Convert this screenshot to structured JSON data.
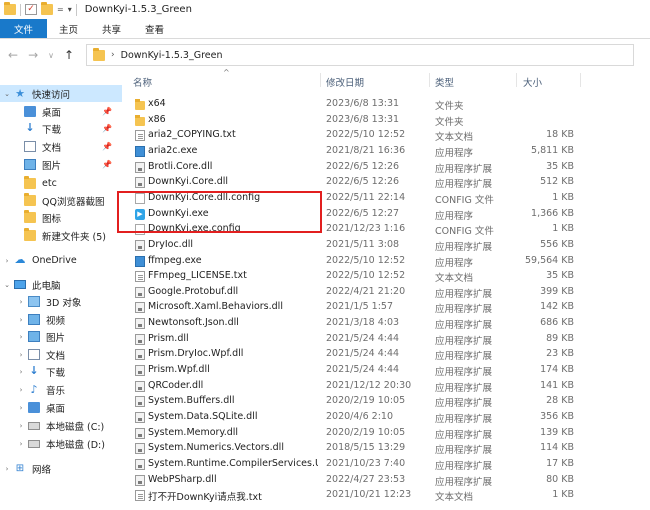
{
  "window": {
    "title": "DownKyi-1.5.3_Green"
  },
  "ribbon": {
    "tabs": [
      "文件",
      "主页",
      "共享",
      "查看"
    ]
  },
  "address": {
    "path": "DownKyi-1.5.3_Green"
  },
  "sidebar": {
    "items": [
      {
        "label": "快速访问",
        "icon": "star-icon",
        "kind": "group"
      },
      {
        "label": "桌面",
        "icon": "desktop-icon",
        "pinned": true
      },
      {
        "label": "下载",
        "icon": "download-icon",
        "pinned": true
      },
      {
        "label": "文档",
        "icon": "document-icon",
        "pinned": true
      },
      {
        "label": "图片",
        "icon": "picture-icon",
        "pinned": true
      },
      {
        "label": "etc",
        "icon": "folder-icon"
      },
      {
        "label": "QQ浏览器截图",
        "icon": "folder-icon"
      },
      {
        "label": "图标",
        "icon": "folder-icon"
      },
      {
        "label": "新建文件夹 (5)",
        "icon": "folder-icon"
      },
      {
        "label": "OneDrive",
        "icon": "cloud-icon",
        "kind": "group"
      },
      {
        "label": "此电脑",
        "icon": "computer-icon",
        "kind": "group"
      },
      {
        "label": "3D 对象",
        "icon": "cube-icon"
      },
      {
        "label": "视频",
        "icon": "video-icon"
      },
      {
        "label": "图片",
        "icon": "picture-icon"
      },
      {
        "label": "文档",
        "icon": "document-icon"
      },
      {
        "label": "下载",
        "icon": "download-icon"
      },
      {
        "label": "音乐",
        "icon": "music-icon"
      },
      {
        "label": "桌面",
        "icon": "desktop-icon"
      },
      {
        "label": "本地磁盘 (C:)",
        "icon": "drive-icon"
      },
      {
        "label": "本地磁盘 (D:)",
        "icon": "drive-icon"
      },
      {
        "label": "网络",
        "icon": "network-icon",
        "kind": "group"
      }
    ]
  },
  "columns": {
    "name": "名称",
    "date": "修改日期",
    "type": "类型",
    "size": "大小"
  },
  "files": [
    {
      "name": "x64",
      "date": "2023/6/8 13:31",
      "type": "文件夹",
      "size": "",
      "icon": "folder"
    },
    {
      "name": "x86",
      "date": "2023/6/8 13:31",
      "type": "文件夹",
      "size": "",
      "icon": "folder"
    },
    {
      "name": "aria2_COPYING.txt",
      "date": "2022/5/10 12:52",
      "type": "文本文档",
      "size": "18 KB",
      "icon": "txt"
    },
    {
      "name": "aria2c.exe",
      "date": "2021/8/21 16:36",
      "type": "应用程序",
      "size": "5,811 KB",
      "icon": "exe"
    },
    {
      "name": "Brotli.Core.dll",
      "date": "2022/6/5 12:26",
      "type": "应用程序扩展",
      "size": "35 KB",
      "icon": "dll"
    },
    {
      "name": "DownKyi.Core.dll",
      "date": "2022/6/5 12:26",
      "type": "应用程序扩展",
      "size": "512 KB",
      "icon": "dll"
    },
    {
      "name": "DownKyi.Core.dll.config",
      "date": "2022/5/11 22:14",
      "type": "CONFIG 文件",
      "size": "1 KB",
      "icon": "cfg"
    },
    {
      "name": "DownKyi.exe",
      "date": "2022/6/5 12:27",
      "type": "应用程序",
      "size": "1,366 KB",
      "icon": "app"
    },
    {
      "name": "DownKyi.exe.config",
      "date": "2021/12/23 1:16",
      "type": "CONFIG 文件",
      "size": "1 KB",
      "icon": "cfg"
    },
    {
      "name": "DryIoc.dll",
      "date": "2021/5/11 3:08",
      "type": "应用程序扩展",
      "size": "556 KB",
      "icon": "dll"
    },
    {
      "name": "ffmpeg.exe",
      "date": "2022/5/10 12:52",
      "type": "应用程序",
      "size": "59,564 KB",
      "icon": "exe"
    },
    {
      "name": "FFmpeg_LICENSE.txt",
      "date": "2022/5/10 12:52",
      "type": "文本文档",
      "size": "35 KB",
      "icon": "txt"
    },
    {
      "name": "Google.Protobuf.dll",
      "date": "2022/4/21 21:20",
      "type": "应用程序扩展",
      "size": "399 KB",
      "icon": "dll"
    },
    {
      "name": "Microsoft.Xaml.Behaviors.dll",
      "date": "2021/1/5 1:57",
      "type": "应用程序扩展",
      "size": "142 KB",
      "icon": "dll"
    },
    {
      "name": "Newtonsoft.Json.dll",
      "date": "2021/3/18 4:03",
      "type": "应用程序扩展",
      "size": "686 KB",
      "icon": "dll"
    },
    {
      "name": "Prism.dll",
      "date": "2021/5/24 4:44",
      "type": "应用程序扩展",
      "size": "89 KB",
      "icon": "dll"
    },
    {
      "name": "Prism.DryIoc.Wpf.dll",
      "date": "2021/5/24 4:44",
      "type": "应用程序扩展",
      "size": "23 KB",
      "icon": "dll"
    },
    {
      "name": "Prism.Wpf.dll",
      "date": "2021/5/24 4:44",
      "type": "应用程序扩展",
      "size": "174 KB",
      "icon": "dll"
    },
    {
      "name": "QRCoder.dll",
      "date": "2021/12/12 20:30",
      "type": "应用程序扩展",
      "size": "141 KB",
      "icon": "dll"
    },
    {
      "name": "System.Buffers.dll",
      "date": "2020/2/19 10:05",
      "type": "应用程序扩展",
      "size": "28 KB",
      "icon": "dll"
    },
    {
      "name": "System.Data.SQLite.dll",
      "date": "2020/4/6 2:10",
      "type": "应用程序扩展",
      "size": "356 KB",
      "icon": "dll"
    },
    {
      "name": "System.Memory.dll",
      "date": "2020/2/19 10:05",
      "type": "应用程序扩展",
      "size": "139 KB",
      "icon": "dll"
    },
    {
      "name": "System.Numerics.Vectors.dll",
      "date": "2018/5/15 13:29",
      "type": "应用程序扩展",
      "size": "114 KB",
      "icon": "dll"
    },
    {
      "name": "System.Runtime.CompilerServices.Un...",
      "date": "2021/10/23 7:40",
      "type": "应用程序扩展",
      "size": "17 KB",
      "icon": "dll"
    },
    {
      "name": "WebPSharp.dll",
      "date": "2022/4/27 23:53",
      "type": "应用程序扩展",
      "size": "80 KB",
      "icon": "dll"
    },
    {
      "name": "打不开DownKyi请点我.txt",
      "date": "2021/10/21 12:23",
      "type": "文本文档",
      "size": "1 KB",
      "icon": "txt"
    }
  ],
  "highlight_color": "#e21f1f"
}
